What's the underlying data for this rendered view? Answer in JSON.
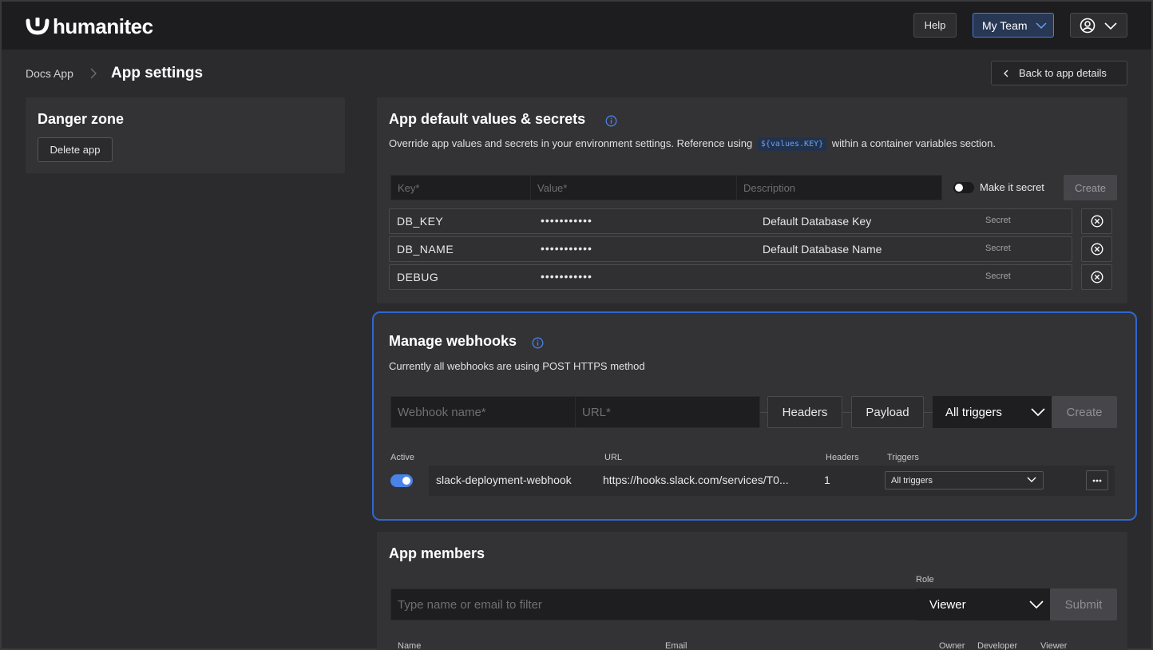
{
  "header": {
    "logo_text": "humanitec",
    "help_label": "Help",
    "team_label": "My Team",
    "user_icon": "user-circle-icon"
  },
  "breadcrumb": {
    "parent": "Docs App",
    "current": "App settings",
    "back_label": "Back to app details"
  },
  "danger_zone": {
    "title": "Danger zone",
    "delete_label": "Delete app"
  },
  "secrets": {
    "title": "App default values & secrets",
    "desc_before": "Override app values and secrets in your environment settings. Reference using",
    "code": "${values.KEY}",
    "desc_after": "within a container variables section.",
    "key_placeholder": "Key*",
    "value_placeholder": "Value*",
    "description_placeholder": "Description",
    "secret_toggle_label": "Make it secret",
    "create_label": "Create",
    "rows": [
      {
        "key": "DB_KEY",
        "value": "•••••••••••",
        "description": "Default Database Key",
        "secret": "Secret"
      },
      {
        "key": "DB_NAME",
        "value": "•••••••••••",
        "description": "Default Database Name",
        "secret": "Secret"
      },
      {
        "key": "DEBUG",
        "value": "•••••••••••",
        "description": "",
        "secret": "Secret"
      }
    ]
  },
  "webhooks": {
    "title": "Manage webhooks",
    "desc": "Currently all webhooks are using POST HTTPS method",
    "name_placeholder": "Webhook name*",
    "url_placeholder": "URL*",
    "headers_label": "Headers",
    "payload_label": "Payload",
    "triggers_label": "All triggers",
    "create_label": "Create",
    "columns": {
      "active": "Active",
      "url": "URL",
      "headers": "Headers",
      "triggers": "Triggers"
    },
    "rows": [
      {
        "active": true,
        "name": "slack-deployment-webhook",
        "url": "https://hooks.slack.com/services/T0...",
        "headers": "1",
        "triggers": "All triggers"
      }
    ]
  },
  "members": {
    "title": "App members",
    "filter_placeholder": "Type name or email to filter",
    "role_label": "Role",
    "role_value": "Viewer",
    "submit_label": "Submit",
    "columns": {
      "name": "Name",
      "email": "Email",
      "owner": "Owner",
      "developer": "Developer",
      "viewer": "Viewer"
    }
  },
  "colors": {
    "accent": "#2f67d0",
    "toggle_on": "#4a82e8",
    "code_chip": "#6aa1ee",
    "background": "#2b2b2d",
    "panel": "#333336",
    "topbar": "#1d1d1f"
  }
}
